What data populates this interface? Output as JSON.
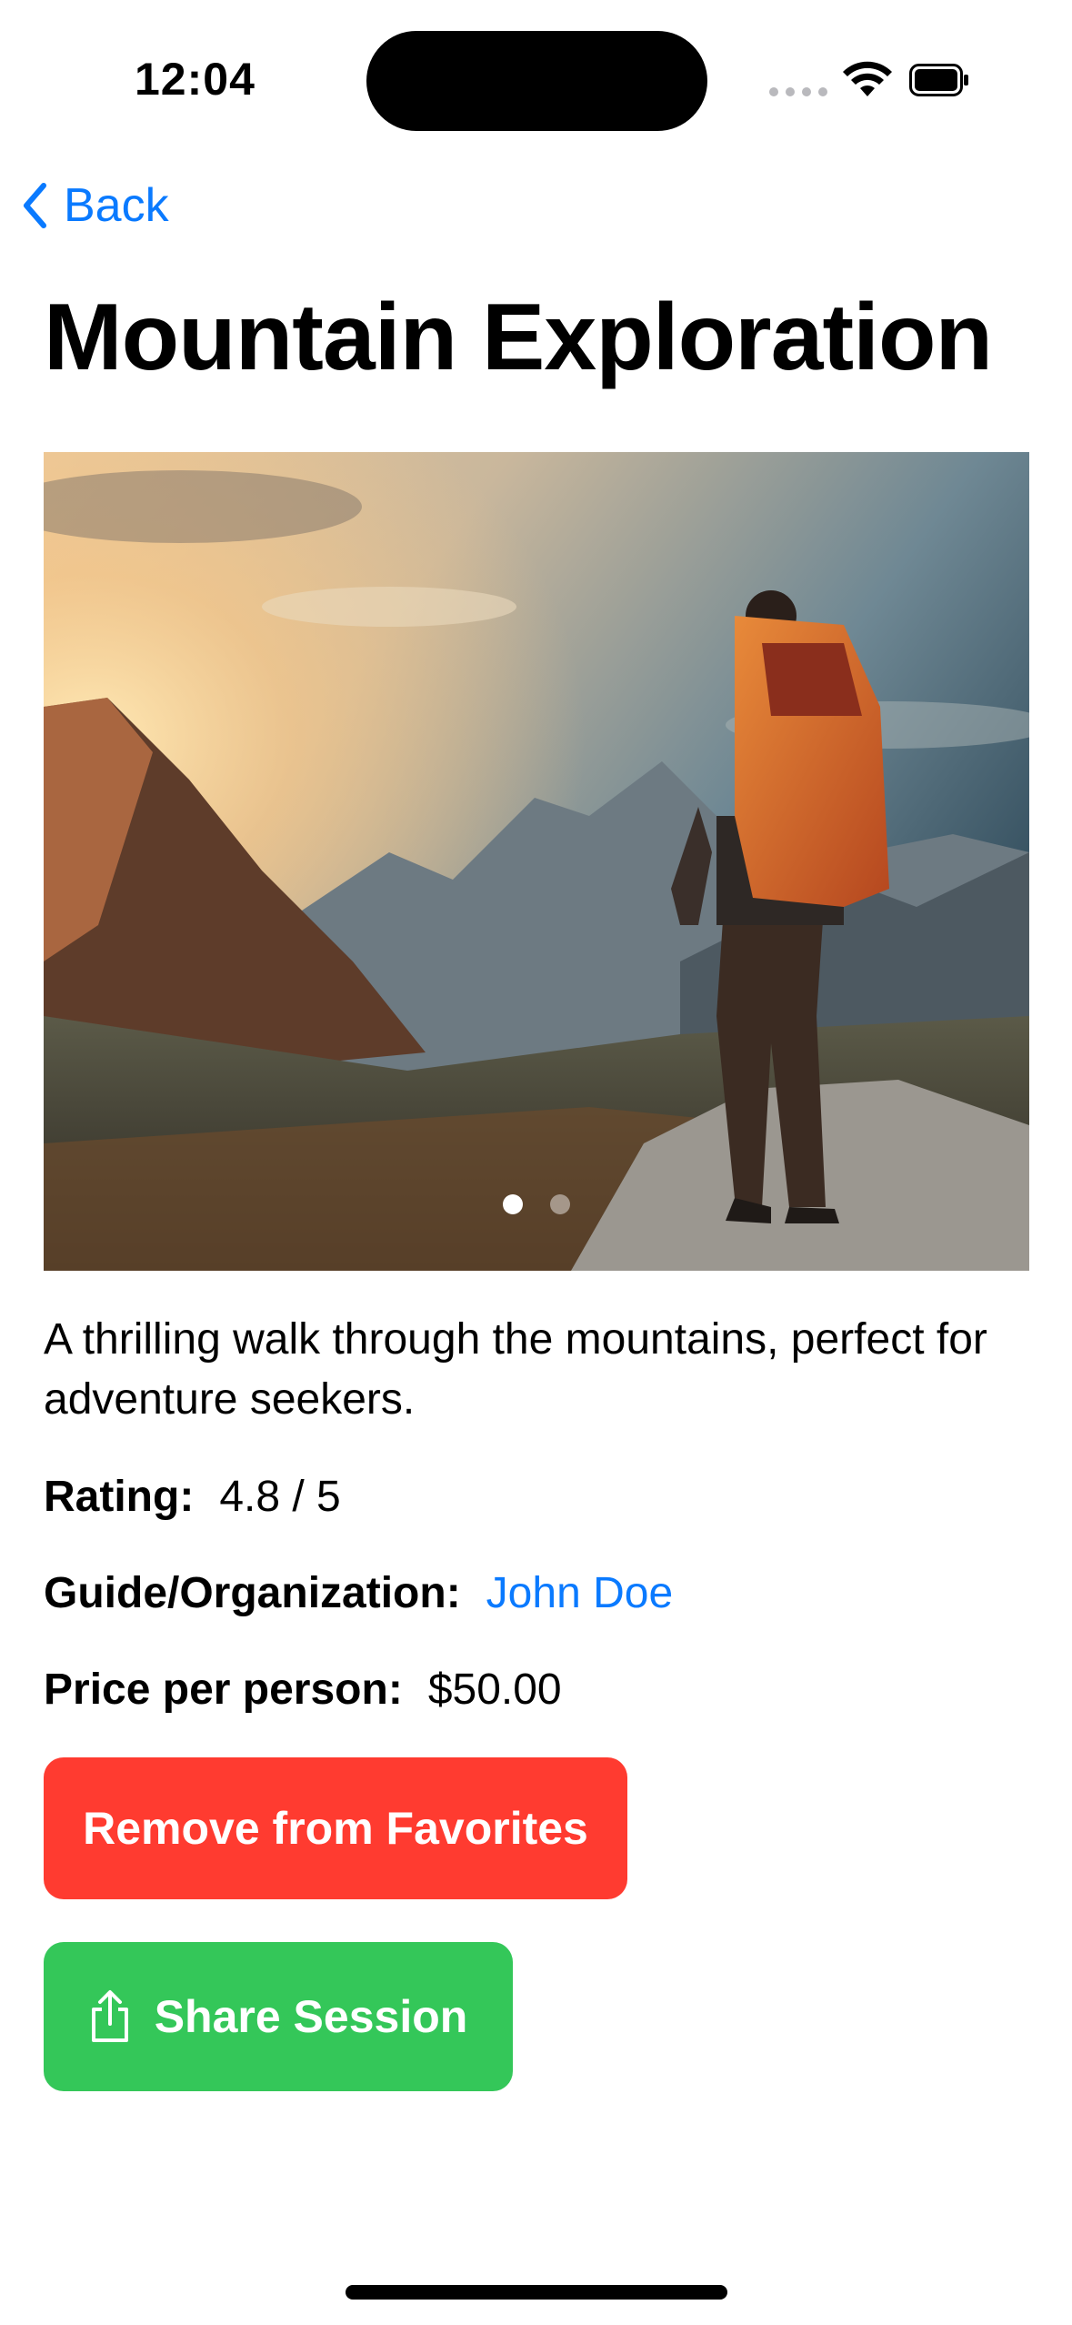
{
  "status_bar": {
    "time": "12:04"
  },
  "nav": {
    "back_label": "Back"
  },
  "page": {
    "title": "Mountain Exploration"
  },
  "carousel": {
    "page_count": 2,
    "current_page": 1
  },
  "details": {
    "description": "A thrilling walk through the mountains, perfect for adventure seekers.",
    "rating_label": "Rating:",
    "rating_value": "4.8 / 5",
    "guide_label": "Guide/Organization:",
    "guide_value": "John Doe",
    "price_label": "Price per person:",
    "price_value": "$50.00"
  },
  "actions": {
    "remove_label": "Remove from Favorites",
    "share_label": "Share Session"
  },
  "colors": {
    "accent": "#0A7AFF",
    "remove": "#FF3B30",
    "share": "#34C759"
  }
}
